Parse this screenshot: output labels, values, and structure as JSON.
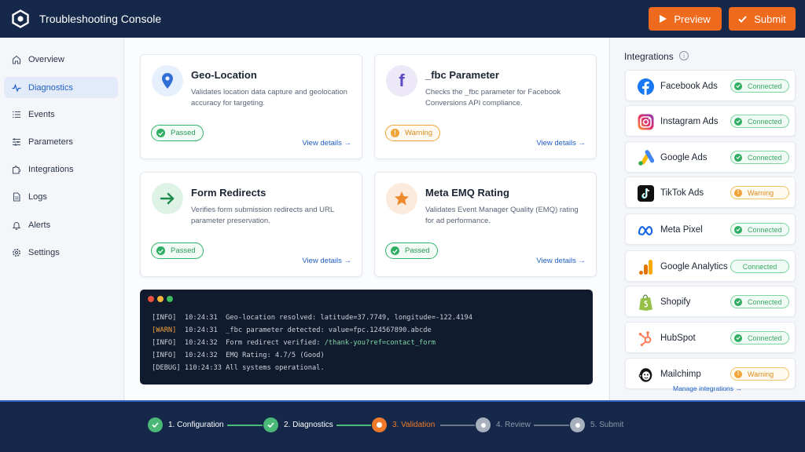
{
  "header": {
    "title": "Troubleshooting Console",
    "preview_label": "Preview",
    "submit_label": "Submit",
    "accent_color": "#f06a1d",
    "bg_color": "#15284a"
  },
  "sidebar": {
    "items": [
      {
        "label": "Overview",
        "icon": "home-icon"
      },
      {
        "label": "Diagnostics",
        "icon": "pulse-icon",
        "active": true
      },
      {
        "label": "Events",
        "icon": "list-icon"
      },
      {
        "label": "Parameters",
        "icon": "sliders-icon"
      },
      {
        "label": "Integrations",
        "icon": "puzzle-icon"
      },
      {
        "label": "Logs",
        "icon": "document-icon"
      },
      {
        "label": "Alerts",
        "icon": "bell-icon"
      },
      {
        "label": "Settings",
        "icon": "gear-icon"
      }
    ]
  },
  "cards": [
    {
      "title": "Geo-Location",
      "description": "Validates location data capture and geolocation accuracy for targeting.",
      "status": "Passed",
      "link": "View details",
      "icon": "map-pin-icon"
    },
    {
      "title": "_fbc Parameter",
      "description": "Checks the _fbc parameter for Facebook Conversions API compliance.",
      "status": "Warning",
      "link": "View details",
      "icon": "facebook-icon"
    },
    {
      "title": "Form Redirects",
      "description": "Verifies form submission redirects and URL parameter preservation.",
      "status": "Passed",
      "link": "View details",
      "icon": "arrow-right-icon"
    },
    {
      "title": "Meta EMQ Rating",
      "description": "Validates Event Manager Quality (EMQ) rating for ad performance.",
      "status": "Passed",
      "link": "View details",
      "icon": "star-icon"
    }
  ],
  "console": {
    "lines": [
      {
        "level": "[INFO]",
        "time": "10:24:31",
        "text": "Geo-location resolved: latitude=37.7749, longitude=-122.4194",
        "highlight": ""
      },
      {
        "level": "[WARN]",
        "time": "10:24:31",
        "text": "_fbc parameter detected: value=fpc.124567890.abcde",
        "highlight": ""
      },
      {
        "level": "[INFO]",
        "time": "10:24:32",
        "text": "Form redirect verified: ",
        "highlight": "/thank-you?ref=contact_form"
      },
      {
        "level": "[INFO]",
        "time": "10:24:32",
        "text": "EMQ Rating: 4.7/5 (Good)",
        "highlight": ""
      },
      {
        "level": "[DEBUG]",
        "time": "110:24:33",
        "text": "All systems operational.",
        "highlight": ""
      }
    ]
  },
  "integrations": {
    "title": "Integrations",
    "manage_label": "Manage integrations →",
    "items": [
      {
        "name": "Facebook Ads",
        "status": "Connected"
      },
      {
        "name": "Instagram Ads",
        "status": "Connected"
      },
      {
        "name": "Google Ads",
        "status": "Connected"
      },
      {
        "name": "TikTok Ads",
        "status": "Warning"
      },
      {
        "name": "Meta Pixel",
        "status": "Connected"
      },
      {
        "name": "Google Analytics 4",
        "status": "Connected"
      },
      {
        "name": "Shopify",
        "status": "Connected"
      },
      {
        "name": "HubSpot",
        "status": "Connected"
      },
      {
        "name": "Mailchimp",
        "status": "Warning"
      }
    ]
  },
  "steps": [
    {
      "label": "1. Configuration",
      "state": "done"
    },
    {
      "label": "2. Diagnostics",
      "state": "done"
    },
    {
      "label": "3. Validation",
      "state": "current"
    },
    {
      "label": "4. Review",
      "state": "todo"
    },
    {
      "label": "5. Submit",
      "state": "todo"
    }
  ]
}
